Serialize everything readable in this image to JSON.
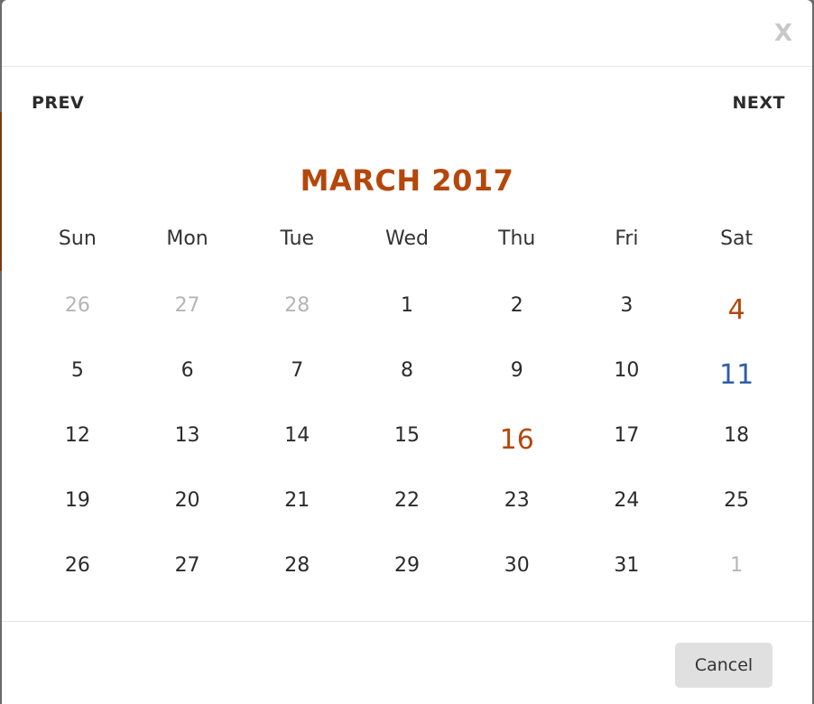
{
  "dialog": {
    "close_label": "X"
  },
  "calendar": {
    "prev_label": "PREV",
    "next_label": "NEXT",
    "month_title": "MARCH 2017",
    "weekdays": [
      "Sun",
      "Mon",
      "Tue",
      "Wed",
      "Thu",
      "Fri",
      "Sat"
    ],
    "days": [
      {
        "label": "26",
        "state": "other-month"
      },
      {
        "label": "27",
        "state": "other-month"
      },
      {
        "label": "28",
        "state": "other-month"
      },
      {
        "label": "1",
        "state": "normal"
      },
      {
        "label": "2",
        "state": "normal"
      },
      {
        "label": "3",
        "state": "normal"
      },
      {
        "label": "4",
        "state": "highlight-orange"
      },
      {
        "label": "5",
        "state": "normal"
      },
      {
        "label": "6",
        "state": "normal"
      },
      {
        "label": "7",
        "state": "normal"
      },
      {
        "label": "8",
        "state": "normal"
      },
      {
        "label": "9",
        "state": "normal"
      },
      {
        "label": "10",
        "state": "normal"
      },
      {
        "label": "11",
        "state": "highlight-blue"
      },
      {
        "label": "12",
        "state": "normal"
      },
      {
        "label": "13",
        "state": "normal"
      },
      {
        "label": "14",
        "state": "normal"
      },
      {
        "label": "15",
        "state": "normal"
      },
      {
        "label": "16",
        "state": "highlight-orange"
      },
      {
        "label": "17",
        "state": "normal"
      },
      {
        "label": "18",
        "state": "normal"
      },
      {
        "label": "19",
        "state": "normal"
      },
      {
        "label": "20",
        "state": "normal"
      },
      {
        "label": "21",
        "state": "normal"
      },
      {
        "label": "22",
        "state": "normal"
      },
      {
        "label": "23",
        "state": "normal"
      },
      {
        "label": "24",
        "state": "normal"
      },
      {
        "label": "25",
        "state": "normal"
      },
      {
        "label": "26",
        "state": "normal"
      },
      {
        "label": "27",
        "state": "normal"
      },
      {
        "label": "28",
        "state": "normal"
      },
      {
        "label": "29",
        "state": "normal"
      },
      {
        "label": "30",
        "state": "normal"
      },
      {
        "label": "31",
        "state": "normal"
      },
      {
        "label": "1",
        "state": "other-month"
      }
    ]
  },
  "footer": {
    "cancel_label": "Cancel"
  },
  "colors": {
    "accent_orange": "#b5470b",
    "accent_blue": "#2f5fa5",
    "muted_text": "#b5b5b5"
  }
}
